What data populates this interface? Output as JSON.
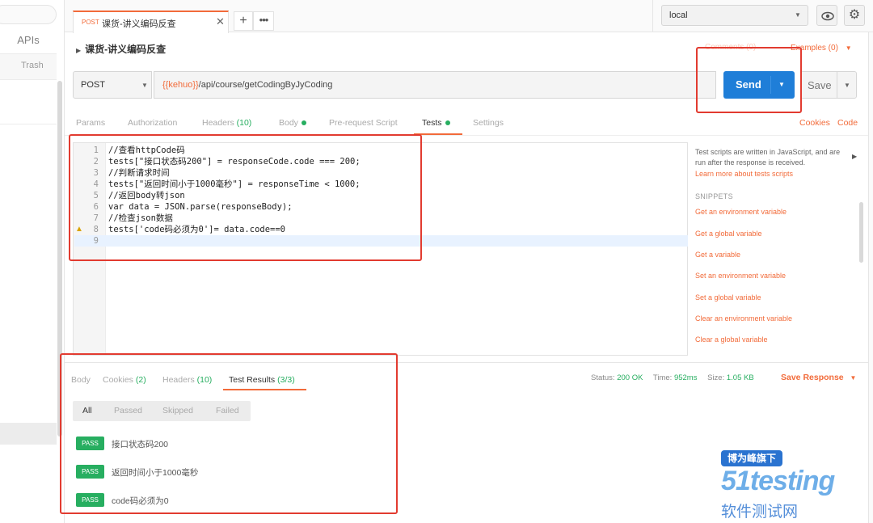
{
  "sidebar": {
    "apis_label": "APIs",
    "trash_label": "Trash"
  },
  "tab": {
    "method": "POST",
    "title": "课货-讲义编码反查",
    "close": "✕",
    "add": "+",
    "more": "•••"
  },
  "environment": {
    "value": "local"
  },
  "request": {
    "title": "课货-讲义编码反查",
    "comments": "Comments (0)",
    "examples": "Examples (0)",
    "method": "POST",
    "url_var": "{{kehuo}}",
    "url_path": "/api/course/getCodingByJyCoding",
    "send_label": "Send",
    "save_label": "Save"
  },
  "subtabs": {
    "params": "Params",
    "authorization": "Authorization",
    "headers": "Headers",
    "headers_count": "(10)",
    "body": "Body",
    "prerequest": "Pre-request Script",
    "tests": "Tests",
    "settings": "Settings",
    "cookies": "Cookies",
    "code": "Code"
  },
  "editor": {
    "lines": [
      {
        "n": "1",
        "code": "//查看httpCode码"
      },
      {
        "n": "2",
        "code": "tests[\"接口状态码200\"] = responseCode.code === 200;"
      },
      {
        "n": "3",
        "code": "//判断请求时间"
      },
      {
        "n": "4",
        "code": "tests[\"返回时间小于1000毫秒\"] = responseTime < 1000;"
      },
      {
        "n": "5",
        "code": "//返回body转json"
      },
      {
        "n": "6",
        "code": "var data = JSON.parse(responseBody);"
      },
      {
        "n": "7",
        "code": "//检查json数据"
      },
      {
        "n": "8",
        "code": "tests['code码必须为0']= data.code==0"
      },
      {
        "n": "9",
        "code": ""
      }
    ]
  },
  "snippets": {
    "description": "Test scripts are written in JavaScript, and are run after the response is received.",
    "learn_more": "Learn more about tests scripts",
    "heading": "SNIPPETS",
    "items": [
      "Get an environment variable",
      "Get a global variable",
      "Get a variable",
      "Set an environment variable",
      "Set a global variable",
      "Clear an environment variable",
      "Clear a global variable"
    ]
  },
  "response": {
    "tabs": {
      "body": "Body",
      "cookies": "Cookies",
      "cookies_count": "(2)",
      "headers": "Headers",
      "headers_count": "(10)",
      "test_results": "Test Results",
      "test_results_count": "(3/3)"
    },
    "status_label": "Status:",
    "status_value": "200 OK",
    "time_label": "Time:",
    "time_value": "952ms",
    "size_label": "Size:",
    "size_value": "1.05 KB",
    "save_response": "Save Response",
    "filters": [
      "All",
      "Passed",
      "Skipped",
      "Failed"
    ],
    "results": [
      {
        "badge": "PASS",
        "name": "接口状态码200"
      },
      {
        "badge": "PASS",
        "name": "返回时间小于1000毫秒"
      },
      {
        "badge": "PASS",
        "name": "code码必须为0"
      }
    ]
  },
  "watermark": {
    "line1": "博为峰旗下",
    "line2": "51testing",
    "line3": "软件测试网"
  },
  "colors": {
    "accent": "#f26b3a",
    "send": "#1f7ed8",
    "pass": "#27ae60",
    "annotation": "#e23b30"
  }
}
